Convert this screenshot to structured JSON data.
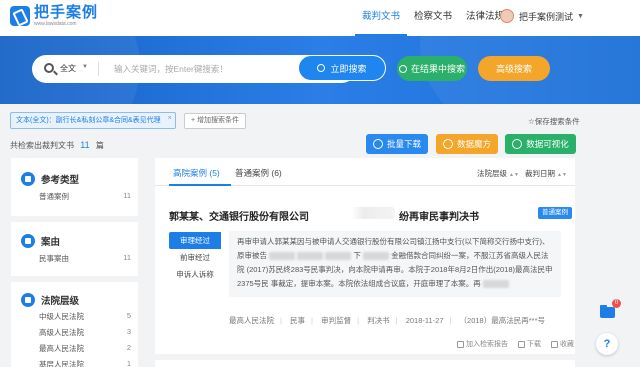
{
  "header": {
    "logo_text": "把手案例",
    "logo_url": "www.lawsdata.com",
    "nav": [
      {
        "label": "裁判文书",
        "active": true
      },
      {
        "label": "检察文书",
        "active": false
      },
      {
        "label": "法律法规",
        "active": false
      }
    ],
    "user_name": "把手案例测试"
  },
  "search": {
    "scope": "全文",
    "placeholder": "输入关键词，按Enter键搜索！",
    "search_button": "立即搜索",
    "within_button": "在结果中搜索",
    "advanced_button": "高级搜索"
  },
  "filters": {
    "chip": "文本(全文)：副行长&私刻公章&合同&表见代理",
    "chip_close": "×",
    "add_filter": "+ 增加搜索条件",
    "save_filter": "☆保存搜索条件"
  },
  "results": {
    "count_prefix": "共检索出裁判文书",
    "count": "11",
    "count_suffix": "篇"
  },
  "actions": {
    "download": "批量下载",
    "collection": "数据魔方",
    "visualize": "数据可视化"
  },
  "sidebar": {
    "sections": [
      {
        "title": "参考类型",
        "items": [
          {
            "label": "普通案例",
            "count": "11"
          }
        ]
      },
      {
        "title": "案由",
        "items": [
          {
            "label": "民事案由",
            "count": "11"
          }
        ]
      },
      {
        "title": "法院层级",
        "items": [
          {
            "label": "中级人民法院",
            "count": "5"
          },
          {
            "label": "高级人民法院",
            "count": "3"
          },
          {
            "label": "最高人民法院",
            "count": "2"
          },
          {
            "label": "基层人民法院",
            "count": "1"
          }
        ]
      }
    ]
  },
  "main": {
    "tabs": [
      {
        "label": "高院案例 (5)",
        "active": true
      },
      {
        "label": "普通案例 (6)",
        "active": false
      }
    ],
    "sort_court": "法院层级",
    "sort_date": "裁判日期",
    "case": {
      "title_start": "郭某某、交通银行股份有限公司",
      "title_end": "纷再审民事判决书",
      "badge": "普通案例",
      "side_tabs": [
        "审理经过",
        "前审经过",
        "申诉人诉称"
      ],
      "abstract_1": "再审申请人郭某某因与被申请人交通银行股份有限公司镇江扬中支行(以下简称交行扬中支行)、原审被告",
      "abstract_2": "下",
      "abstract_3": "金融借款合同纠纷一案，不服江苏省高级人民法院",
      "abstract_4": "(2017)苏民终283号民事判决，向本院申请再审。本院于2018年8月2日作出(2018)最高法民申2375号民",
      "abstract_5": "事裁定，提审本案。本院依法组成合议庭，开庭审理了本案。再",
      "meta": [
        "最高人民法院",
        "民事",
        "审判监督",
        "判决书",
        "2018-11-27",
        "（2018）最高法民再***号"
      ],
      "card_actions": [
        "加入检索报告",
        "下载",
        "收藏"
      ]
    }
  },
  "floating": {
    "folder_badge": "0",
    "help": "?"
  },
  "colors": {
    "primary": "#1e7ee8",
    "green": "#2ab06a",
    "orange": "#f3a629"
  }
}
